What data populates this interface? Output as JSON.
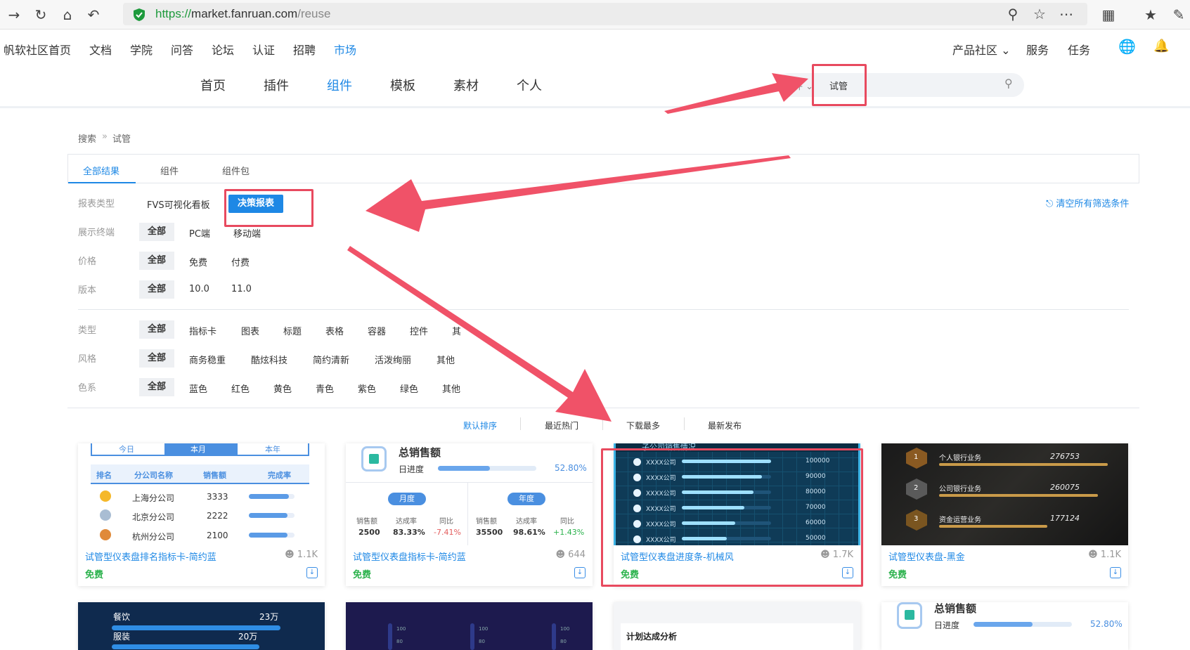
{
  "browser": {
    "url_scheme": "https://",
    "url_host": "market.fanruan.com",
    "url_path": "/reuse"
  },
  "topnav": {
    "items": [
      "帆软社区首页",
      "文档",
      "学院",
      "问答",
      "论坛",
      "认证",
      "招聘",
      "市场"
    ],
    "right": [
      "产品社区",
      "服务",
      "任务"
    ]
  },
  "market_tabs": [
    "首页",
    "插件",
    "组件",
    "模板",
    "素材",
    "个人"
  ],
  "search": {
    "scope": "组件",
    "query": "试管"
  },
  "breadcrumb": {
    "root": "搜索",
    "sep": "»",
    "current": "试管"
  },
  "result_tabs": [
    "全部结果",
    "组件",
    "组件包"
  ],
  "filters": {
    "report_type": {
      "label": "报表类型",
      "options": [
        "FVS可视化看板",
        "决策报表"
      ]
    },
    "terminal": {
      "label": "展示终端",
      "options": [
        "全部",
        "PC端",
        "移动端"
      ]
    },
    "price": {
      "label": "价格",
      "options": [
        "全部",
        "免费",
        "付费"
      ]
    },
    "version": {
      "label": "版本",
      "options": [
        "全部",
        "10.0",
        "11.0"
      ]
    },
    "type": {
      "label": "类型",
      "options": [
        "全部",
        "指标卡",
        "图表",
        "标题",
        "表格",
        "容器",
        "控件",
        "其"
      ]
    },
    "style": {
      "label": "风格",
      "options": [
        "全部",
        "商务稳重",
        "酷炫科技",
        "简约清新",
        "活泼绚丽",
        "其他"
      ]
    },
    "color": {
      "label": "色系",
      "options": [
        "全部",
        "蓝色",
        "红色",
        "黄色",
        "青色",
        "紫色",
        "绿色",
        "其他"
      ]
    },
    "clear": "清空所有筛选条件"
  },
  "sort": [
    "默认排序",
    "最近热门",
    "下载最多",
    "最新发布"
  ],
  "cards": [
    {
      "title": "试管型仪表盘排名指标卡-简约蓝",
      "downloads": "1.1K",
      "price": "免费"
    },
    {
      "title": "试管型仪表盘指标卡-简约蓝",
      "downloads": "644",
      "price": "免费"
    },
    {
      "title": "试管型仪表盘进度条-机械风",
      "downloads": "1.7K",
      "price": "免费"
    },
    {
      "title": "试管型仪表盘-黑金",
      "downloads": "1.1K",
      "price": "免费"
    }
  ],
  "thumb1": {
    "tabs": [
      "今日",
      "本月",
      "本年"
    ],
    "headers": [
      "排名",
      "分公司名称",
      "销售额",
      "完成率"
    ],
    "rows": [
      {
        "name": "上海分公司",
        "value": "3333"
      },
      {
        "name": "北京分公司",
        "value": "2222"
      },
      {
        "name": "杭州分公司",
        "value": "2100"
      }
    ]
  },
  "thumb2": {
    "title": "总销售额",
    "sub": "日进度",
    "pct": "52.80%",
    "month_tag": "月度",
    "year_tag": "年度",
    "labels": [
      "销售额",
      "达成率",
      "同比"
    ],
    "month_vals": [
      "2500",
      "83.33%",
      "-7.41%"
    ],
    "year_vals": [
      "35500",
      "98.61%",
      "+1.43%"
    ]
  },
  "thumb3": {
    "title": "子公司销售情况",
    "rows": [
      {
        "name": "XXXX公司",
        "value": "100000",
        "fill": 1.0
      },
      {
        "name": "XXXX公司",
        "value": "90000",
        "fill": 0.9
      },
      {
        "name": "XXXX公司",
        "value": "80000",
        "fill": 0.8
      },
      {
        "name": "XXXX公司",
        "value": "70000",
        "fill": 0.7
      },
      {
        "name": "XXXX公司",
        "value": "60000",
        "fill": 0.6
      },
      {
        "name": "XXXX公司",
        "value": "50000",
        "fill": 0.5
      }
    ]
  },
  "thumb4": {
    "rows": [
      {
        "rank": "1",
        "name": "个人银行业务",
        "value": "276753"
      },
      {
        "rank": "2",
        "name": "公司银行业务",
        "value": "260075"
      },
      {
        "rank": "3",
        "name": "资金运营业务",
        "value": "177124"
      }
    ]
  },
  "row2": {
    "c1": [
      {
        "name": "餐饮",
        "value": "23万"
      },
      {
        "name": "服装",
        "value": "20万"
      }
    ],
    "c2_ticks": [
      "100",
      "80"
    ],
    "c3_title": "计划达成分析",
    "c4": {
      "title": "总销售额",
      "sub": "日进度",
      "pct": "52.80%"
    }
  },
  "colors": {
    "accent": "#1e88e5",
    "annotation": "#e84a5f",
    "free": "#2bb24c"
  }
}
